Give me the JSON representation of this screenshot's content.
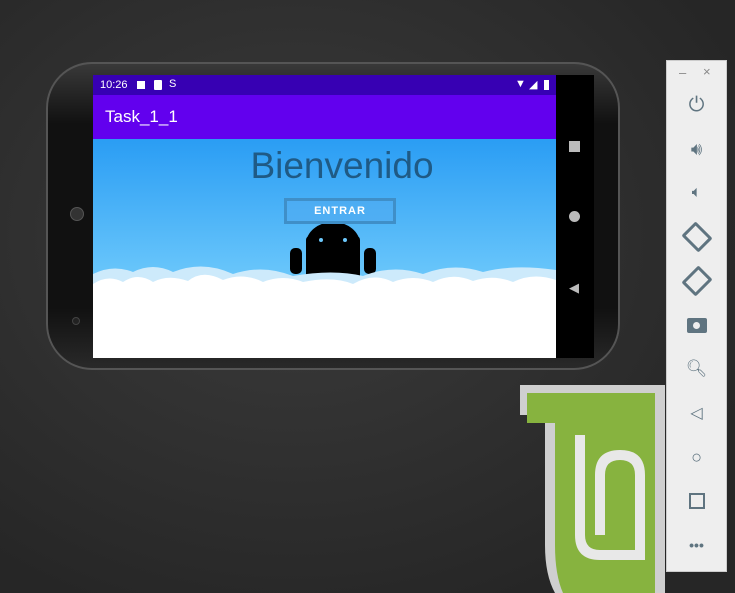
{
  "status_bar": {
    "time": "10:26"
  },
  "app_bar": {
    "title": "Task_1_1"
  },
  "content": {
    "heading": "Bienvenido",
    "button_label": "ENTRAR"
  },
  "colors": {
    "status_bar": "#3700b3",
    "app_bar": "#6200ee",
    "sky": "#2a9df4",
    "heading": "#1f5a85"
  },
  "emulator_toolbar": {
    "items": [
      "power",
      "volume-up",
      "volume-down",
      "rotate-left",
      "rotate-right",
      "screenshot",
      "zoom",
      "back",
      "home",
      "overview",
      "more"
    ]
  }
}
